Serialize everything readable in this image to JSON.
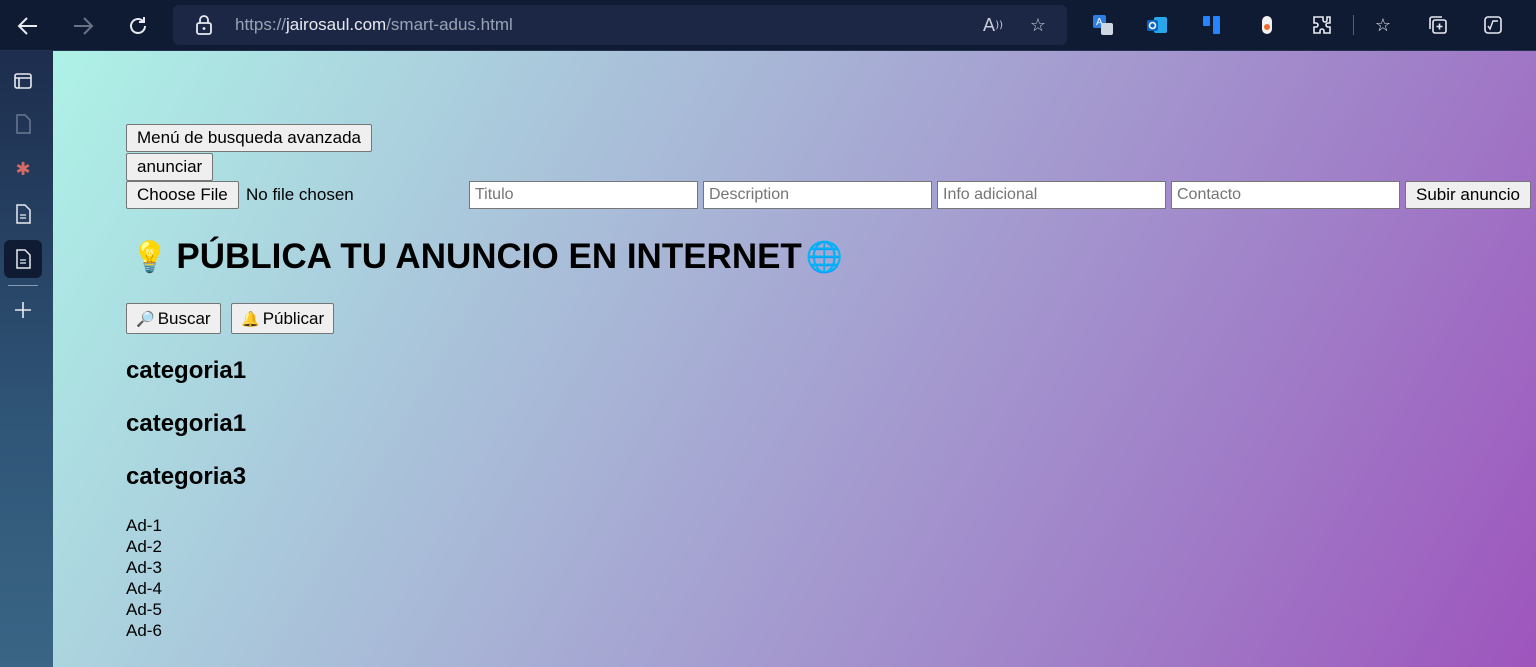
{
  "browser": {
    "url_scheme": "https://",
    "url_host": "jairosaul.com",
    "url_path": "/smart-adus.html",
    "icons": [
      "back-icon",
      "forward-icon",
      "refresh-icon",
      "lock-icon",
      "read-aloud-icon",
      "add-favorite-icon",
      "translate-icon",
      "outlook-icon",
      "trello-icon",
      "extension-record-icon",
      "extensions-icon",
      "favorites-icon",
      "collections-icon",
      "math-solver-icon"
    ]
  },
  "sidebar": {
    "icons": [
      "tab-actions-icon",
      "page-icon",
      "asterisk-icon",
      "page-icon",
      "page-icon",
      "add-icon"
    ]
  },
  "page": {
    "advanced_search_button": "Menú de busqueda avanzada",
    "announce_button": "anunciar",
    "file_button": "Choose File",
    "file_status": "No file chosen",
    "fields": {
      "title_placeholder": "Titulo",
      "description_placeholder": "Description",
      "info_placeholder": "Info adicional",
      "contact_placeholder": "Contacto"
    },
    "submit_button": "Subir anuncio",
    "headline": "PÚBLICA TU ANUNCIO EN INTERNET",
    "headline_icon_left": "💡",
    "headline_icon_right": "🌐",
    "search_button": "Buscar",
    "search_icon": "🔎",
    "publish_button": "Públicar",
    "publish_icon": "🔔",
    "categories": [
      "categoria1",
      "categoria1",
      "categoria3"
    ],
    "ads": [
      "Ad-1",
      "Ad-2",
      "Ad-3",
      "Ad-4",
      "Ad-5",
      "Ad-6"
    ]
  },
  "colors": {
    "gradient_start": "#aef2e7",
    "gradient_end": "#9e55bd",
    "browser_bar": "#0f1b33"
  }
}
